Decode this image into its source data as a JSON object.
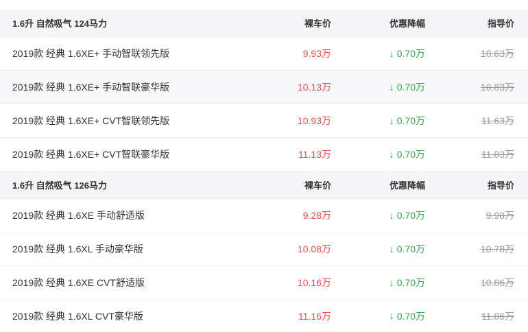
{
  "groups": [
    {
      "header": {
        "title": "1.6升 自然吸气 124马力",
        "price": "裸车价",
        "discount": "优惠降幅",
        "guide": "指导价"
      },
      "rows": [
        {
          "name": "2019款 经典 1.6XE+ 手动智联领先版",
          "price": "9.93万",
          "discount": "0.70万",
          "guide": "10.63万"
        },
        {
          "name": "2019款 经典 1.6XE+ 手动智联豪华版",
          "price": "10.13万",
          "discount": "0.70万",
          "guide": "10.83万"
        },
        {
          "name": "2019款 经典 1.6XE+ CVT智联领先版",
          "price": "10.93万",
          "discount": "0.70万",
          "guide": "11.63万"
        },
        {
          "name": "2019款 经典 1.6XE+ CVT智联豪华版",
          "price": "11.13万",
          "discount": "0.70万",
          "guide": "11.83万"
        }
      ]
    },
    {
      "header": {
        "title": "1.6升 自然吸气 126马力",
        "price": "裸车价",
        "discount": "优惠降幅",
        "guide": "指导价"
      },
      "rows": [
        {
          "name": "2019款 经典 1.6XE 手动舒适版",
          "price": "9.28万",
          "discount": "0.70万",
          "guide": "9.98万"
        },
        {
          "name": "2019款 经典 1.6XL 手动豪华版",
          "price": "10.08万",
          "discount": "0.70万",
          "guide": "10.78万"
        },
        {
          "name": "2019款 经典 1.6XE CVT舒适版",
          "price": "10.16万",
          "discount": "0.70万",
          "guide": "10.86万"
        },
        {
          "name": "2019款 经典 1.6XL CVT豪华版",
          "price": "11.16万",
          "discount": "0.70万",
          "guide": "11.86万"
        }
      ]
    }
  ],
  "icons": {
    "discount_arrow": "down-arrow-icon"
  },
  "colors": {
    "price": "#f24b4b",
    "discount": "#31a84a",
    "guide": "#999999",
    "header_bg": "#f5f5f7"
  }
}
